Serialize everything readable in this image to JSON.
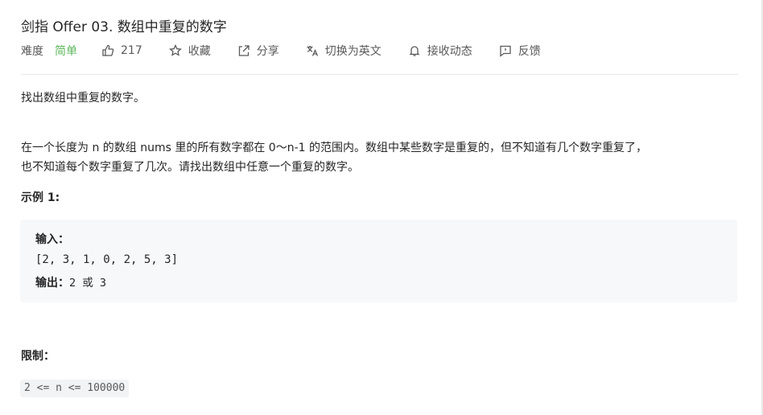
{
  "problem": {
    "title": "剑指 Offer 03. 数组中重复的数字"
  },
  "toolbar": {
    "difficulty_label": "难度",
    "difficulty_value": "简单",
    "likes": "217",
    "favorite_label": "收藏",
    "share_label": "分享",
    "switch_lang_label": "切换为英文",
    "notify_label": "接收动态",
    "feedback_label": "反馈"
  },
  "description": {
    "intro": "找出数组中重复的数字。",
    "line1": "在一个长度为 n 的数组 nums 里的所有数字都在 0～n-1 的范围内。数组中某些数字是重复的，但不知道有几个数字重复了，",
    "line2": "也不知道每个数字重复了几次。请找出数组中任意一个重复的数字。"
  },
  "example": {
    "heading": "示例 1:",
    "input_label": "输入：",
    "input_value": "[2, 3, 1, 0, 2, 5, 3]",
    "output_label": "输出：",
    "output_value": "2 或 3"
  },
  "limits": {
    "heading": "限制：",
    "constraint": "2 <= n <= 100000"
  },
  "colors": {
    "easy": "#5cb85c",
    "code_bg": "#f7f8fa",
    "text": "#262626",
    "muted": "#595959"
  }
}
